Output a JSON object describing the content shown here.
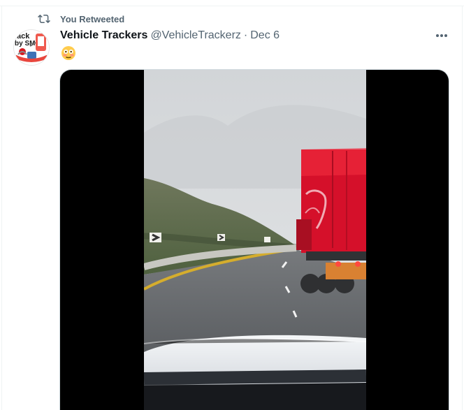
{
  "retweet": {
    "label": "You Retweeted"
  },
  "tweet": {
    "author_name": "Vehicle Trackers",
    "handle": "@VehicleTrackerz",
    "separator": "·",
    "date": "Dec 6",
    "text_emoji": "😳"
  },
  "avatar": {
    "logo_text": "Track by SMS"
  },
  "icons": {
    "retweet": "retweet-icon",
    "more": "more-icon",
    "flushed": "flushed-face-emoji"
  },
  "colors": {
    "secondary_text": "#536471",
    "primary_text": "#0f1419",
    "border": "#cfd9de",
    "truck_red": "#d5102a",
    "media_background": "#000000"
  }
}
